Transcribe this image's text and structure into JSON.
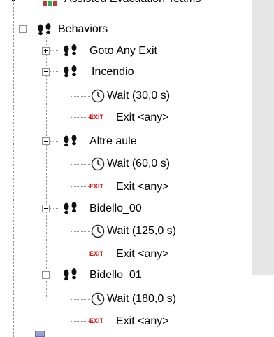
{
  "tree": {
    "partial_top_label": "Assisted Evacuation Teams",
    "behaviors": {
      "label": "Behaviors",
      "items": [
        {
          "label": "Goto Any Exit",
          "expanded": false,
          "children": []
        },
        {
          "label": "Incendio",
          "expanded": true,
          "children": [
            {
              "type": "wait",
              "label": "Wait (30,0 s)"
            },
            {
              "type": "exit",
              "badge": "EXIT",
              "label": "Exit <any>"
            }
          ]
        },
        {
          "label": "Altre aule",
          "expanded": true,
          "children": [
            {
              "type": "wait",
              "label": "Wait (60,0 s)"
            },
            {
              "type": "exit",
              "badge": "EXIT",
              "label": "Exit <any>"
            }
          ]
        },
        {
          "label": "Bidello_00",
          "expanded": true,
          "children": [
            {
              "type": "wait",
              "label": "Wait (125,0 s)"
            },
            {
              "type": "exit",
              "badge": "EXIT",
              "label": "Exit <any>"
            }
          ]
        },
        {
          "label": "Bidello_01",
          "expanded": true,
          "children": [
            {
              "type": "wait",
              "label": "Wait (180,0 s)"
            },
            {
              "type": "exit",
              "badge": "EXIT",
              "label": "Exit <any>"
            }
          ]
        }
      ]
    }
  },
  "icons": {
    "behavior": "footprints-icon",
    "wait": "clock-icon",
    "exit": "exit-badge-icon"
  },
  "colors": {
    "exit_red": "#e00000",
    "tree_line": "#8f8f8f",
    "scrollbar": "#e6e6e6"
  }
}
